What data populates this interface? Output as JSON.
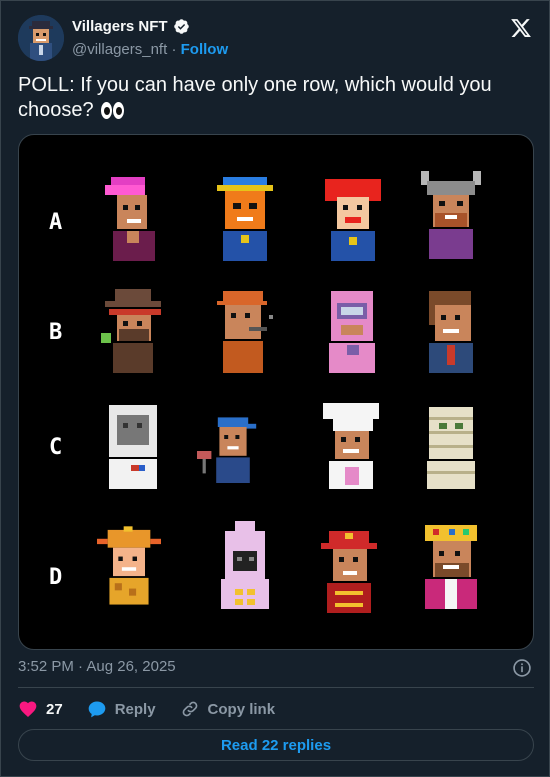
{
  "author": {
    "name": "Villagers NFT",
    "handle": "@villagers_nft",
    "separator": "·",
    "follow_label": "Follow",
    "avatar_icon": "pixel-villager-avatar",
    "verified_icon": "verified-badge-icon"
  },
  "tweet": {
    "text": "POLL: If you can have only one row, which would you choose?",
    "emoji": "eyes-emoji"
  },
  "image": {
    "rows": [
      {
        "label": "A",
        "villagers": [
          "pink-mohawk-villager",
          "blue-hat-orange-mask-villager",
          "red-hair-clown-villager",
          "viking-helmet-villager"
        ]
      },
      {
        "label": "B",
        "villagers": [
          "cowboy-hat-villager",
          "orange-cap-pipe-villager",
          "pink-diver-villager",
          "brown-hair-suit-villager"
        ]
      },
      {
        "label": "C",
        "villagers": [
          "astronaut-villager",
          "blue-cap-villager",
          "chef-hat-villager",
          "mummy-villager"
        ]
      },
      {
        "label": "D",
        "villagers": [
          "flame-crown-villager",
          "pink-hood-villager",
          "red-cap-firefighter-villager",
          "gold-crown-king-villager"
        ]
      }
    ]
  },
  "meta": {
    "time": "3:52 PM",
    "separator": "·",
    "date": "Aug 26, 2025"
  },
  "actions": {
    "like_count": "27",
    "reply_label": "Reply",
    "copy_link_label": "Copy link"
  },
  "read_replies_label": "Read 22 replies",
  "colors": {
    "background": "#15202b",
    "accent": "#1d9bf0",
    "like": "#f91880",
    "muted": "#8b98a5"
  }
}
